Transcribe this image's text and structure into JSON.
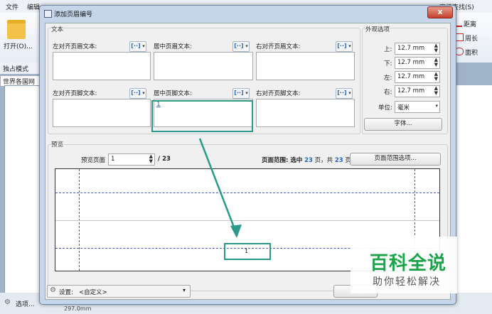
{
  "app": {
    "menu": [
      "文件",
      "编辑"
    ],
    "open_label": "打开(O)...",
    "toolbar_label": "独占模式",
    "doc_tab": "世界各国网",
    "right_top": "高级查找(S)",
    "right_buttons": [
      "距离",
      "周长",
      "面积"
    ],
    "status_left": "选项...",
    "status_size": "297.0mm"
  },
  "dialog": {
    "title": "添加页眉编号",
    "close": "x",
    "text_group": "文本",
    "header_left_label": "左对齐页眉文本:",
    "header_center_label": "居中页眉文本:",
    "header_right_label": "右对齐页眉文本:",
    "footer_left_label": "左对齐页脚文本:",
    "footer_center_label": "居中页脚文本:",
    "footer_right_label": "右对齐页脚文本:",
    "macro_button": "[··]",
    "footer_center_value": "1",
    "appearance_group": "外观选项",
    "margins": [
      {
        "label": "上:",
        "value": "12.7 mm"
      },
      {
        "label": "下:",
        "value": "12.7 mm"
      },
      {
        "label": "左:",
        "value": "12.7 mm"
      },
      {
        "label": "右:",
        "value": "12.7 mm"
      }
    ],
    "unit_label": "单位:",
    "unit_value": "毫米",
    "font_button": "字体...",
    "preview_group": "预览",
    "preview_page_label": "预览页面",
    "preview_page_value": "1",
    "preview_total": "/ 23",
    "page_range_prefix": "页面范围: 选中",
    "page_range_selected": "23",
    "page_range_mid": "页，共",
    "page_range_total": "23",
    "page_range_suffix": "页",
    "page_range_button": "页面范围选项...",
    "preview_footer_number": "1",
    "settings_label": "设置:",
    "settings_value": "<自定义>"
  },
  "watermark": {
    "title": "百科全说",
    "subtitle": "助你轻松解决"
  },
  "colors": {
    "highlight": "#2a9a8a",
    "guide": "#4a59c8",
    "watermark_green": "#1ba34a"
  }
}
